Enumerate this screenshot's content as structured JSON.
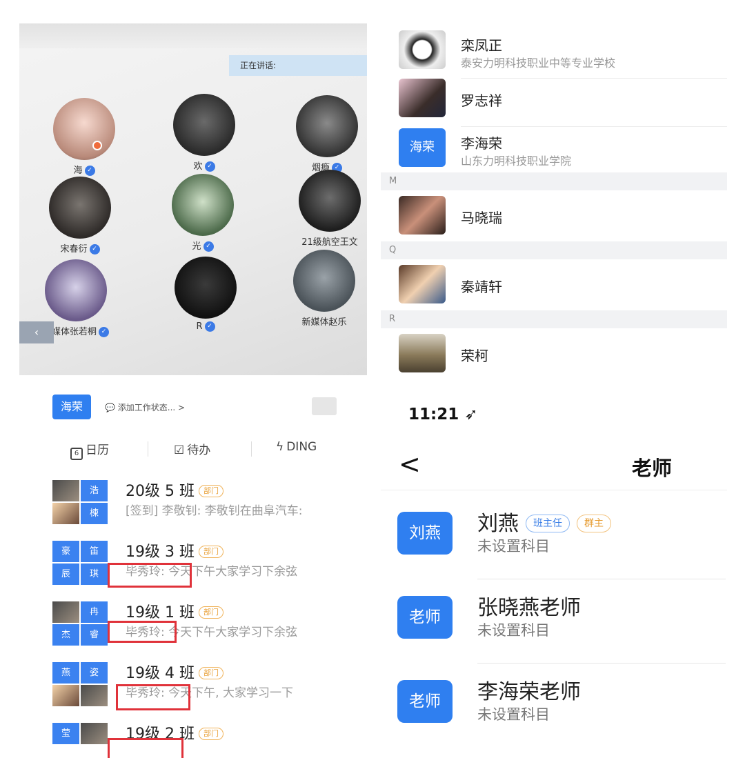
{
  "meeting": {
    "speaking_label": "正在讲话:",
    "members": [
      {
        "name": "海"
      },
      {
        "name": "欢"
      },
      {
        "name": "烟瘾"
      },
      {
        "name": "宋春衍"
      },
      {
        "name": "光"
      },
      {
        "name": "21级航空王文"
      },
      {
        "name": "新媒体张若桐"
      },
      {
        "name": "R"
      },
      {
        "name": "新媒体赵乐"
      }
    ],
    "back_arrow": "‹"
  },
  "chat": {
    "user_badge": "海荣",
    "status_placeholder": "添加工作状态... >",
    "tools": [
      {
        "icon": "6",
        "label": "日历"
      },
      {
        "icon": "☑",
        "label": "待办"
      },
      {
        "icon": "ϟ",
        "label": "DING"
      }
    ],
    "dept_tag": "部门",
    "rows": [
      {
        "title": "20级 5 班",
        "message": "[签到] 李敬钊: 李敬钊在曲阜汽车:",
        "cells": [
          "",
          "浩",
          "",
          "楝"
        ]
      },
      {
        "title": "19级 3 班",
        "message": "毕秀玲: 今天下午大家学习下余弦",
        "cells": [
          "豪",
          "笛",
          "辰",
          "琪"
        ]
      },
      {
        "title": "19级 1 班",
        "message": "毕秀玲: 今天下午大家学习下余弦",
        "cells": [
          "",
          "冉",
          "杰",
          "睿"
        ]
      },
      {
        "title": "19级 4 班",
        "message": "毕秀玲: 今天下午, 大家学习一下",
        "cells": [
          "燕",
          "姿",
          "",
          ""
        ]
      },
      {
        "title": "19级 2 班",
        "message": "",
        "cells": [
          "莹",
          "",
          "",
          ""
        ]
      }
    ]
  },
  "contacts": {
    "letters": [
      "M",
      "Q",
      "R"
    ],
    "items": [
      {
        "name": "栾凤正",
        "org": "泰安力明科技职业中等专业学校"
      },
      {
        "name": "罗志祥",
        "org": ""
      },
      {
        "name": "李海荣",
        "org": "山东力明科技职业学院",
        "badge": "海荣"
      },
      {
        "name": "马晓瑞",
        "org": ""
      },
      {
        "name": "秦靖轩",
        "org": ""
      },
      {
        "name": "荣柯",
        "org": ""
      }
    ]
  },
  "teachers": {
    "clock": "11:21",
    "back": "<",
    "title": "老师",
    "items": [
      {
        "badge": "刘燕",
        "name": "刘燕",
        "subject": "未设置科目",
        "tags": [
          "班主任",
          "群主"
        ]
      },
      {
        "badge": "老师",
        "name": "张晓燕老师",
        "subject": "未设置科目"
      },
      {
        "badge": "老师",
        "name": "李海荣老师",
        "subject": "未设置科目"
      }
    ]
  }
}
